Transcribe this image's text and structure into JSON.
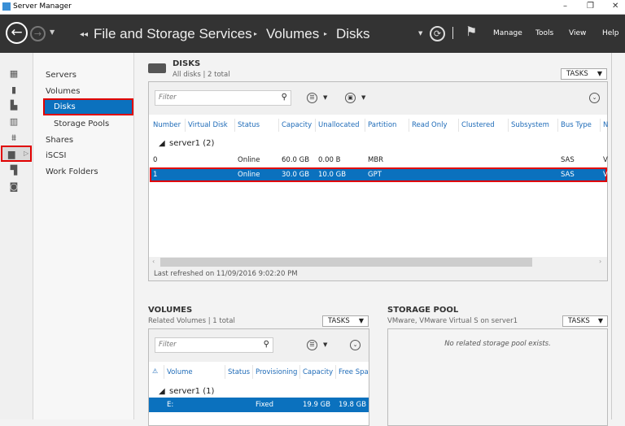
{
  "window": {
    "title": "Server Manager",
    "minimize": "–",
    "restore": "❐",
    "close": "✕"
  },
  "header": {
    "breadcrumb": [
      "File and Storage Services",
      "Volumes",
      "Disks"
    ],
    "menu": [
      "Manage",
      "Tools",
      "View",
      "Help"
    ],
    "bg": "#333333"
  },
  "sidebar": {
    "icons": [
      "dashboard-icon",
      "local-server-icon",
      "all-servers-icon",
      "file-services-icon",
      "iis-icon",
      "file-storage-icon",
      "print-services-icon",
      "remote-access-icon"
    ],
    "active_index": 5
  },
  "nav": {
    "items": [
      {
        "label": "Servers"
      },
      {
        "label": "Volumes"
      },
      {
        "label": "Disks",
        "selected": true
      },
      {
        "label": "Storage Pools"
      },
      {
        "label": "Shares"
      },
      {
        "label": "iSCSI"
      },
      {
        "label": "Work Folders"
      }
    ]
  },
  "disks": {
    "title": "DISKS",
    "subtitle": "All disks | 2 total",
    "tasks": "TASKS",
    "filter_placeholder": "Filter",
    "columns": [
      "Number",
      "Virtual Disk",
      "Status",
      "Capacity",
      "Unallocated",
      "Partition",
      "Read Only",
      "Clustered",
      "Subsystem",
      "Bus Type",
      "N"
    ],
    "group": "server1 (2)",
    "rows": [
      {
        "cells": [
          "0",
          "",
          "Online",
          "60.0 GB",
          "0.00 B",
          "MBR",
          "",
          "",
          "",
          "SAS",
          "V"
        ]
      },
      {
        "cells": [
          "1",
          "",
          "Online",
          "30.0 GB",
          "10.0 GB",
          "GPT",
          "",
          "",
          "",
          "SAS",
          "V"
        ],
        "selected": true
      }
    ],
    "last_refreshed": "Last refreshed on 11/09/2016 9:02:20 PM"
  },
  "volumes": {
    "title": "VOLUMES",
    "subtitle": "Related Volumes | 1 total",
    "tasks": "TASKS",
    "filter_placeholder": "Filter",
    "columns": [
      "Volume",
      "Status",
      "Provisioning",
      "Capacity",
      "Free Spa"
    ],
    "group": "server1 (1)",
    "rows": [
      {
        "cells": [
          "E:",
          "",
          "Fixed",
          "19.9 GB",
          "19.8 GB"
        ],
        "selected": true
      }
    ]
  },
  "storage_pool": {
    "title": "STORAGE POOL",
    "subtitle": "VMware, VMware Virtual S on server1",
    "tasks": "TASKS",
    "empty_message": "No related storage pool exists."
  },
  "colors": {
    "selection": "#0b71be",
    "highlight_border": "#e00000",
    "link": "#1e6bb8"
  }
}
